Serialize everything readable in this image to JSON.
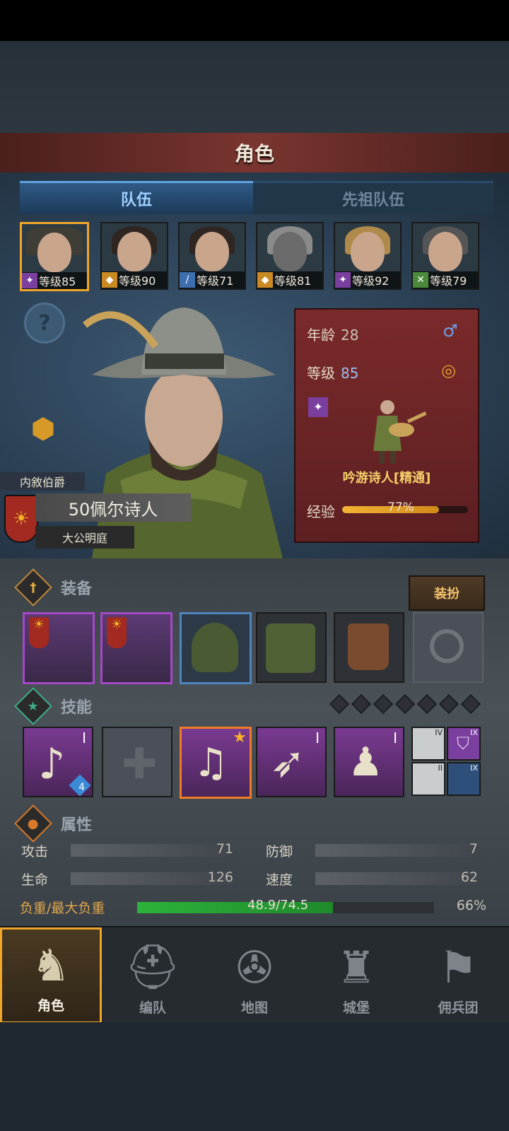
{
  "header": {
    "title": "角色"
  },
  "tabs": [
    {
      "label": "队伍",
      "active": true
    },
    {
      "label": "先祖队伍",
      "active": false
    }
  ],
  "party": [
    {
      "level_text": "等级85",
      "class_icon": "staff-icon",
      "selected": true
    },
    {
      "level_text": "等级90",
      "class_icon": "shield-icon",
      "selected": false
    },
    {
      "level_text": "等级71",
      "class_icon": "sword-icon",
      "selected": false
    },
    {
      "level_text": "等级81",
      "class_icon": "shield-icon",
      "selected": false
    },
    {
      "level_text": "等级92",
      "class_icon": "staff-icon",
      "selected": false
    },
    {
      "level_text": "等级79",
      "class_icon": "bow-icon",
      "selected": false
    }
  ],
  "hero": {
    "rank": "内敘伯爵",
    "name": "50佩尔诗人",
    "faction": "大公明庭"
  },
  "info": {
    "age_label": "年龄",
    "age_value": "28",
    "level_label": "等级",
    "level_value": "85",
    "class_name": "吟游诗人[精通]",
    "xp_label": "经验",
    "xp_percent": "77%",
    "xp_fraction": 0.77
  },
  "equipment": {
    "title": "装备",
    "dress_button": "装扮",
    "slots": [
      {
        "name": "banner-cloak",
        "rarity": "purple"
      },
      {
        "name": "banner-cloak",
        "rarity": "purple"
      },
      {
        "name": "hood",
        "rarity": "blue"
      },
      {
        "name": "tunic",
        "rarity": "common"
      },
      {
        "name": "boots",
        "rarity": "common"
      },
      {
        "name": "ring",
        "rarity": "empty"
      }
    ]
  },
  "skills": {
    "title": "技能",
    "pips": 7,
    "slots": [
      {
        "name": "music-note-skill",
        "tier": "I",
        "badge": "4"
      },
      {
        "name": "empty-skill-slot",
        "tier": "",
        "badge": ""
      },
      {
        "name": "crystal-music-skill",
        "tier": "",
        "badge": ""
      },
      {
        "name": "feather-arrow-skill",
        "tier": "I",
        "badge": ""
      },
      {
        "name": "crystal-party-skill",
        "tier": "I",
        "badge": ""
      }
    ],
    "mini": [
      {
        "tier": "IV"
      },
      {
        "tier": "IX"
      },
      {
        "tier": "II"
      },
      {
        "tier": "IX"
      }
    ]
  },
  "attributes": {
    "title": "属性",
    "stats": [
      {
        "label": "攻击",
        "value": "71"
      },
      {
        "label": "防御",
        "value": "7"
      },
      {
        "label": "生命",
        "value": "126"
      },
      {
        "label": "速度",
        "value": "62"
      }
    ],
    "load_label": "负重/最大负重",
    "load_value": "48.9/74.5",
    "load_percent": "66%",
    "load_fraction": 0.66
  },
  "nav": [
    {
      "label": "角色",
      "icon": "knight-icon",
      "active": true
    },
    {
      "label": "编队",
      "icon": "helmet-icon",
      "active": false
    },
    {
      "label": "地图",
      "icon": "compass-map-icon",
      "active": false
    },
    {
      "label": "城堡",
      "icon": "castle-icon",
      "active": false
    },
    {
      "label": "佣兵团",
      "icon": "banner-fist-icon",
      "active": false
    }
  ]
}
